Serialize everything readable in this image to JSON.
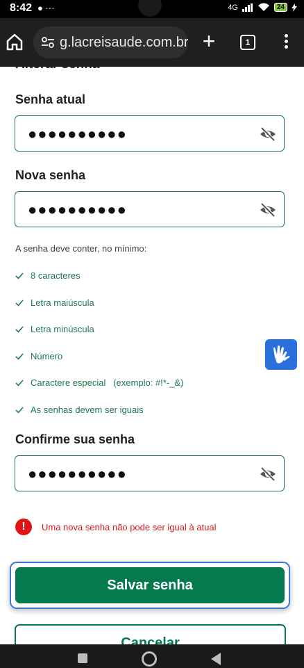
{
  "status_bar": {
    "time": "8:42",
    "notifications": "● ···",
    "network": "4G",
    "battery": "24"
  },
  "browser": {
    "url": "g.lacreisaude.com.br",
    "tab_count": "1"
  },
  "page": {
    "clipped_heading": "Alterar senha",
    "current_password": {
      "label": "Senha atual",
      "value": "●●●●●●●●●●"
    },
    "new_password": {
      "label": "Nova senha",
      "value": "●●●●●●●●●●"
    },
    "rules_intro": "A senha deve conter, no mínimo:",
    "rules": [
      "8 caracteres",
      "Letra maiúscula",
      "Letra minúscula",
      "Número",
      "Caractere especial   (exemplo: #!*-_&)",
      "As senhas devem ser iguais"
    ],
    "confirm_password": {
      "label": "Confirme sua senha",
      "value": "●●●●●●●●●●"
    },
    "error_icon": "!",
    "error_message": "Uma nova senha não pode ser igual à atual",
    "save_label": "Salvar senha",
    "cancel_label": "Cancelar"
  },
  "colors": {
    "primary_green": "#067a4f",
    "error_red": "#d21818",
    "focus_blue": "#3b78d8",
    "a11y_blue": "#2a6fdc"
  }
}
